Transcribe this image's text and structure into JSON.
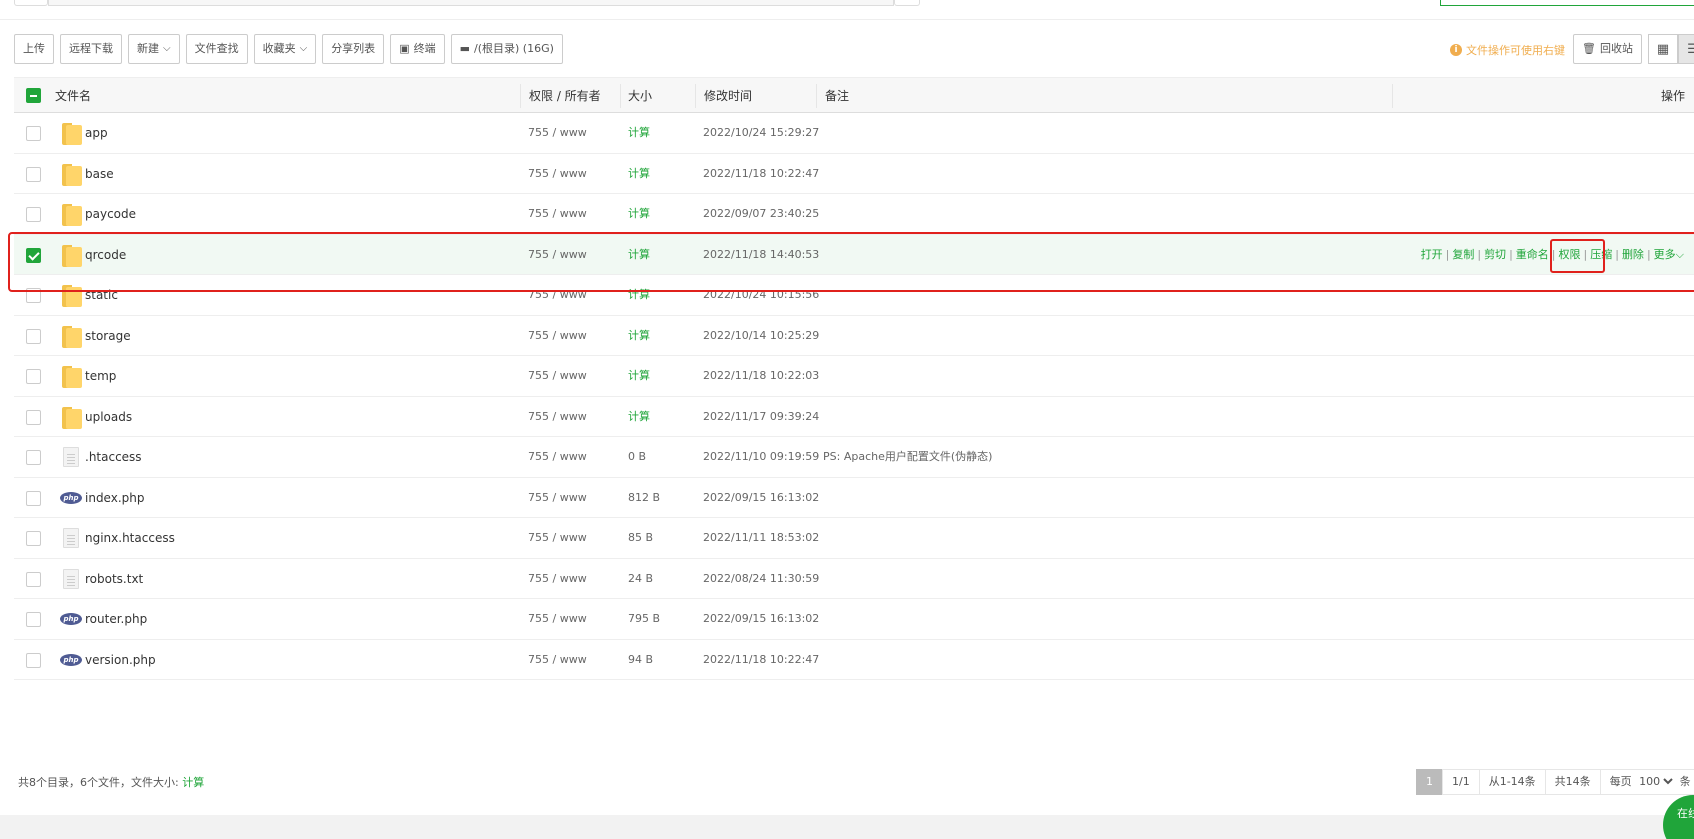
{
  "toolbar": {
    "upload": "上传",
    "remote_download": "远程下载",
    "new": "新建",
    "file_search": "文件查找",
    "favorites": "收藏夹",
    "share_list": "分享列表",
    "terminal": "终端",
    "disk": "/(根目录) (16G)",
    "hint": "文件操作可使用右键",
    "recycle": "回收站"
  },
  "table": {
    "headers": {
      "name": "文件名",
      "perm": "权限 / 所有者",
      "size": "大小",
      "mtime": "修改时间",
      "note": "备注",
      "ops": "操作"
    },
    "rows": [
      {
        "type": "folder",
        "name": "app",
        "perm": "755 / www",
        "size": "计算",
        "mtime": "2022/10/24 15:29:27",
        "note": ""
      },
      {
        "type": "folder",
        "name": "base",
        "perm": "755 / www",
        "size": "计算",
        "mtime": "2022/11/18 10:22:47",
        "note": ""
      },
      {
        "type": "folder",
        "name": "paycode",
        "perm": "755 / www",
        "size": "计算",
        "mtime": "2022/09/07 23:40:25",
        "note": ""
      },
      {
        "type": "folder",
        "name": "qrcode",
        "perm": "755 / www",
        "size": "计算",
        "mtime": "2022/11/18 14:40:53",
        "note": "",
        "selected": true
      },
      {
        "type": "folder",
        "name": "static",
        "perm": "755 / www",
        "size": "计算",
        "mtime": "2022/10/24 10:15:56",
        "note": ""
      },
      {
        "type": "folder",
        "name": "storage",
        "perm": "755 / www",
        "size": "计算",
        "mtime": "2022/10/14 10:25:29",
        "note": ""
      },
      {
        "type": "folder",
        "name": "temp",
        "perm": "755 / www",
        "size": "计算",
        "mtime": "2022/11/18 10:22:03",
        "note": ""
      },
      {
        "type": "folder",
        "name": "uploads",
        "perm": "755 / www",
        "size": "计算",
        "mtime": "2022/11/17 09:39:24",
        "note": ""
      },
      {
        "type": "file",
        "name": ".htaccess",
        "perm": "755 / www",
        "size": "0 B",
        "mtime": "2022/11/10 09:19:59",
        "note": "PS: Apache用户配置文件(伪静态)"
      },
      {
        "type": "php",
        "name": "index.php",
        "perm": "755 / www",
        "size": "812 B",
        "mtime": "2022/09/15 16:13:02",
        "note": ""
      },
      {
        "type": "file",
        "name": "nginx.htaccess",
        "perm": "755 / www",
        "size": "85 B",
        "mtime": "2022/11/11 18:53:02",
        "note": ""
      },
      {
        "type": "file",
        "name": "robots.txt",
        "perm": "755 / www",
        "size": "24 B",
        "mtime": "2022/08/24 11:30:59",
        "note": ""
      },
      {
        "type": "php",
        "name": "router.php",
        "perm": "755 / www",
        "size": "795 B",
        "mtime": "2022/09/15 16:13:02",
        "note": ""
      },
      {
        "type": "php",
        "name": "version.php",
        "perm": "755 / www",
        "size": "94 B",
        "mtime": "2022/11/18 10:22:47",
        "note": ""
      }
    ],
    "row_ops": [
      "打开",
      "复制",
      "剪切",
      "重命名",
      "权限",
      "压缩",
      "删除",
      "更多"
    ]
  },
  "footer": {
    "summary": "共8个目录，6个文件，文件大小:",
    "calc": "计算"
  },
  "pager": {
    "current": "1",
    "pages": "1/1",
    "range": "从1-14条",
    "total": "共14条",
    "per_page_label": "每页",
    "per_page": "100",
    "suffix": "条"
  },
  "chat": "在线客服",
  "colors": {
    "accent": "#20a53a",
    "highlight": "#e0211c",
    "hint": "#f0ad4e"
  }
}
